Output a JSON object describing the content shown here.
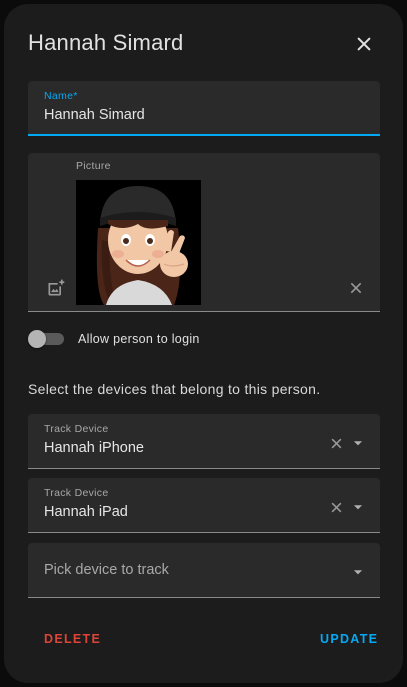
{
  "dialog": {
    "title": "Hannah Simard"
  },
  "name_field": {
    "label": "Name*",
    "value": "Hannah Simard"
  },
  "picture_field": {
    "label": "Picture"
  },
  "login_toggle": {
    "label": "Allow person to login",
    "enabled": false
  },
  "devices_section": {
    "text": "Select the devices that belong to this person."
  },
  "devices": [
    {
      "label": "Track Device",
      "value": "Hannah iPhone"
    },
    {
      "label": "Track Device",
      "value": "Hannah iPad"
    }
  ],
  "device_picker": {
    "placeholder": "Pick device to track"
  },
  "actions": {
    "delete_label": "DELETE",
    "update_label": "UPDATE"
  },
  "colors": {
    "accent": "#03a9f4",
    "danger": "#db4437",
    "surface": "#1c1c1c",
    "field_bg": "#2a2a2a"
  },
  "icons": {
    "close": "close-icon",
    "add_photo": "add-photo-icon",
    "clear": "clear-icon",
    "dropdown": "arrow-drop-down-icon"
  }
}
